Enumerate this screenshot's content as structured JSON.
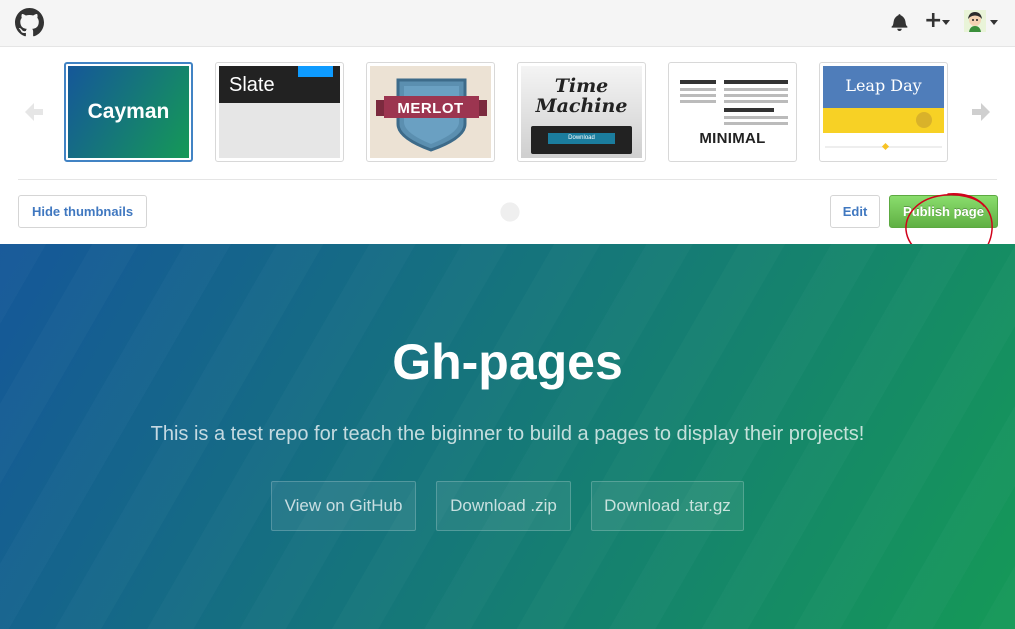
{
  "topbar": {
    "logo_icon": "github-octocat-icon",
    "notifications_icon": "bell-icon",
    "create_new_icon": "plus-icon",
    "create_new_glyph": "+",
    "avatar_icon": "user-avatar"
  },
  "theme_chooser": {
    "prev_icon": "arrow-left-icon",
    "next_icon": "arrow-right-icon",
    "selected": "Cayman",
    "themes": [
      {
        "name": "Cayman",
        "label": "Cayman"
      },
      {
        "name": "Slate",
        "label": "Slate"
      },
      {
        "name": "Merlot",
        "label": "MERLOT"
      },
      {
        "name": "Time Machine",
        "label": "Time Machine",
        "button": "Download"
      },
      {
        "name": "Minimal",
        "label": "MINIMAL"
      },
      {
        "name": "Leap Day",
        "label": "Leap Day"
      }
    ]
  },
  "actions": {
    "hide_thumbnails": "Hide thumbnails",
    "edit": "Edit",
    "publish": "Publish page"
  },
  "hero": {
    "title": "Gh-pages",
    "tagline": "This is a test repo for teach the biginner to build a pages to display their projects!",
    "buttons": [
      "View on GitHub",
      "Download .zip",
      "Download .tar.gz"
    ]
  },
  "colors": {
    "gradient_start": "#155799",
    "gradient_end": "#159957",
    "publish_green": "#60b044",
    "link_blue": "#4078c0",
    "annotation_red": "#d0021b"
  }
}
